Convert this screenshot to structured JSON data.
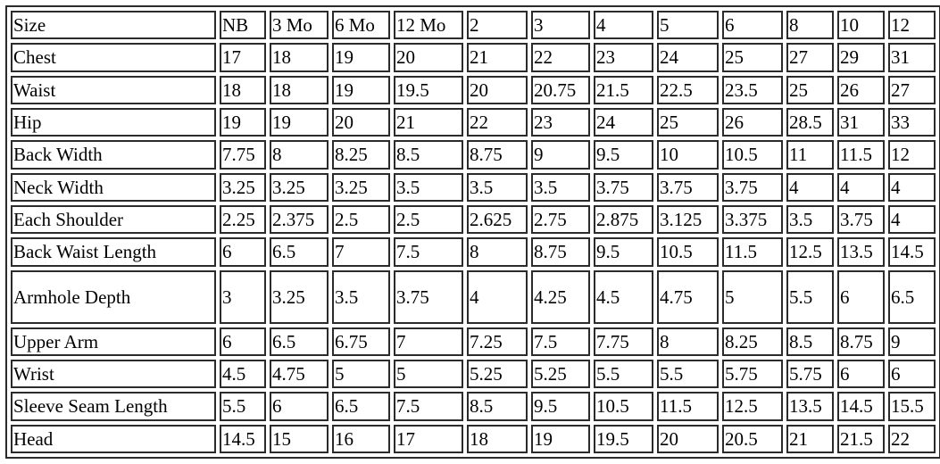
{
  "table": {
    "header": {
      "label": "Size",
      "sizes": [
        "NB",
        "3 Mo",
        "6 Mo",
        "12 Mo",
        "2",
        "3",
        "4",
        "5",
        "6",
        "8",
        "10",
        "12"
      ]
    },
    "rows": [
      {
        "label": "Chest",
        "values": [
          "17",
          "18",
          "19",
          "20",
          "21",
          "22",
          "23",
          "24",
          "25",
          "27",
          "29",
          "31"
        ]
      },
      {
        "label": "Waist",
        "values": [
          "18",
          "18",
          "19",
          "19.5",
          "20",
          "20.75",
          "21.5",
          "22.5",
          "23.5",
          "25",
          "26",
          "27"
        ]
      },
      {
        "label": "Hip",
        "values": [
          "19",
          "19",
          "20",
          "21",
          "22",
          "23",
          "24",
          "25",
          "26",
          "28.5",
          "31",
          "33"
        ]
      },
      {
        "label": "Back Width",
        "values": [
          "7.75",
          "8",
          "8.25",
          "8.5",
          "8.75",
          "9",
          "9.5",
          "10",
          "10.5",
          "11",
          "11.5",
          "12"
        ]
      },
      {
        "label": "Neck Width",
        "values": [
          "3.25",
          "3.25",
          "3.25",
          "3.5",
          "3.5",
          "3.5",
          "3.75",
          "3.75",
          "3.75",
          "4",
          "4",
          "4"
        ]
      },
      {
        "label": "Each Shoulder",
        "values": [
          "2.25",
          "2.375",
          "2.5",
          "2.5",
          "2.625",
          "2.75",
          "2.875",
          "3.125",
          "3.375",
          "3.5",
          "3.75",
          "4"
        ]
      },
      {
        "label": "Back Waist Length",
        "values": [
          "6",
          "6.5",
          "7",
          "7.5",
          "8",
          "8.75",
          "9.5",
          "10.5",
          "11.5",
          "12.5",
          "13.5",
          "14.5"
        ]
      },
      {
        "label": "Armhole Depth",
        "values": [
          "3",
          "3.25",
          "3.5",
          "3.75",
          "4",
          "4.25",
          "4.5",
          "4.75",
          "5",
          "5.5",
          "6",
          "6.5"
        ]
      },
      {
        "label": "Upper Arm",
        "values": [
          "6",
          "6.5",
          "6.75",
          "7",
          "7.25",
          "7.5",
          "7.75",
          "8",
          "8.25",
          "8.5",
          "8.75",
          "9"
        ]
      },
      {
        "label": "Wrist",
        "values": [
          "4.5",
          "4.75",
          "5",
          "5",
          "5.25",
          "5.25",
          "5.5",
          "5.5",
          "5.75",
          "5.75",
          "6",
          "6"
        ]
      },
      {
        "label": "Sleeve Seam Length",
        "values": [
          "5.5",
          "6",
          "6.5",
          "7.5",
          "8.5",
          "9.5",
          "10.5",
          "11.5",
          "12.5",
          "13.5",
          "14.5",
          "15.5"
        ]
      },
      {
        "label": "Head",
        "values": [
          "14.5",
          "15",
          "16",
          "17",
          "18",
          "19",
          "19.5",
          "20",
          "20.5",
          "21",
          "21.5",
          "22"
        ]
      }
    ]
  }
}
